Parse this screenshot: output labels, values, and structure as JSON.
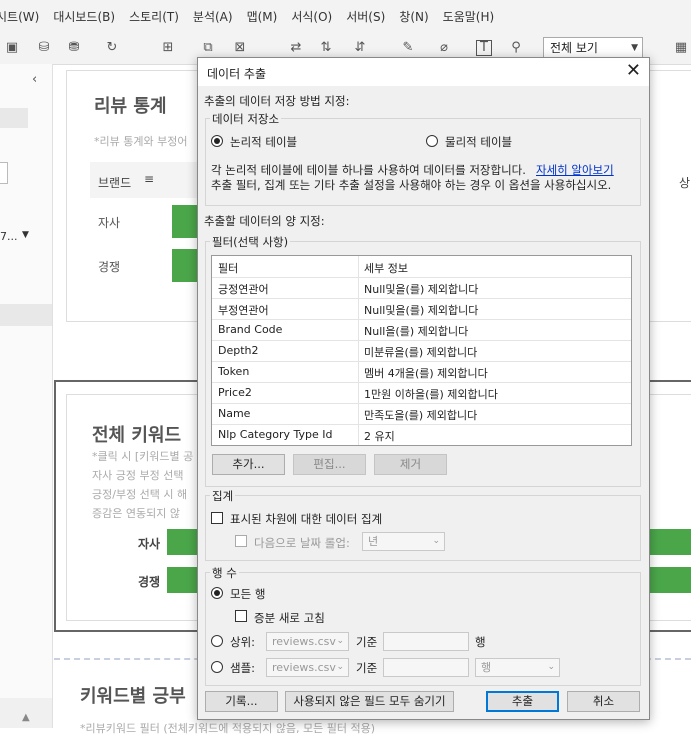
{
  "menubar": {
    "items": [
      "시트(W)",
      "대시보드(B)",
      "스토리(T)",
      "분석(A)",
      "맵(M)",
      "서식(O)",
      "서버(S)",
      "창(N)",
      "도움말(H)"
    ]
  },
  "toolbar": {
    "view_dropdown": "전체 보기"
  },
  "background": {
    "review_title": "리뷰 통계",
    "review_note": "*리뷰 통계와 부정어",
    "brand_header": "브랜드",
    "right_header": "상",
    "row_self": "자사",
    "row_comp": "경쟁",
    "left_dropdown": "7...",
    "keyword_title": "전체 키워드",
    "kw_note1": "*클릭 시 [키워드별 공",
    "kw_note2": "자사 긍정 부정 선택",
    "kw_note3": "긍정/부정 선택 시 해",
    "kw_note4": "증감은 연동되지 않",
    "kw_self": "자사",
    "kw_comp": "경쟁",
    "bottom_title": "키워드별 긍부",
    "bottom_note": "*리뷰키워드 필터 (전체키워드에 적용되지 않음, 모든 필터 적용)"
  },
  "dialog": {
    "title": "데이터 추출",
    "storage_heading": "추출의 데이터 저장 방법 지정:",
    "storage_group": "데이터 저장소",
    "opt_logical": "논리적 테이블",
    "opt_physical": "물리적 테이블",
    "desc1": "각 논리적 테이블에 테이블 하나를 사용하여 데이터를 저장합니다.",
    "learn_more": "자세히 알아보기",
    "desc2": "추출 필터, 집계 또는 기타 추출 설정을 사용해야 하는 경우 이 옵션을 사용하십시오.",
    "amount_heading": "추출할 데이터의 양 지정:",
    "filter_group": "필터(선택 사항)",
    "filter_table": {
      "headers": [
        "필터",
        "세부 정보"
      ],
      "rows": [
        [
          "긍정연관어",
          "Null및을(를) 제외합니다"
        ],
        [
          "부정연관어",
          "Null및을(를) 제외합니다"
        ],
        [
          "Brand Code",
          "Null을(를) 제외합니다"
        ],
        [
          "Depth2",
          "미분류을(를) 제외합니다"
        ],
        [
          "Token",
          "멤버 4개을(를) 제외합니다"
        ],
        [
          "Price2",
          "1만원 이하을(를) 제외합니다"
        ],
        [
          "Name",
          "만족도을(를) 제외합니다"
        ],
        [
          "Nlp Category Type Id",
          "2 유지"
        ]
      ]
    },
    "btn_add": "추가...",
    "btn_edit": "편집...",
    "btn_remove": "제거",
    "agg_group": "집계",
    "agg_visible": "표시된 차원에 대한 데이터 집계",
    "agg_rollup": "다음으로 날짜 롤업:",
    "agg_rollup_value": "년",
    "rows_group": "행 수",
    "rows_all": "모든 행",
    "rows_incremental": "증분 새로 고침",
    "rows_top": "상위:",
    "rows_top_source": "reviews.csv",
    "rows_top_by": "기준",
    "rows_top_unit": "행",
    "rows_sample": "샘플:",
    "rows_sample_source": "reviews.csv",
    "rows_sample_by": "기준",
    "rows_sample_unit": "행",
    "btn_history": "기록...",
    "btn_hide": "사용되지 않은 필드 모두 숨기기",
    "btn_extract": "추출",
    "btn_cancel": "취소"
  },
  "colors": {
    "accent_green": "#4ba64a",
    "link": "#0033cc",
    "default_button": "#0078d7"
  }
}
